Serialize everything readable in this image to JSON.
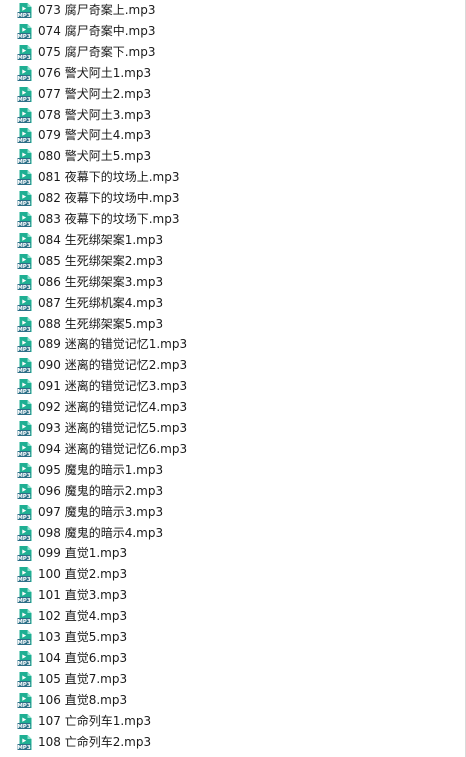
{
  "window": {
    "view": "file-list",
    "icon_name": "mp3-file-icon",
    "icon_label": "MP3",
    "colors": {
      "icon_teal": "#1faf93",
      "icon_fold": "#8fe3cf",
      "icon_badge": "#2d6f87",
      "text": "#1a1a1a",
      "background": "#ffffff"
    }
  },
  "files": [
    {
      "name": "073 腐尸奇案上.mp3"
    },
    {
      "name": "074 腐尸奇案中.mp3"
    },
    {
      "name": "075 腐尸奇案下.mp3"
    },
    {
      "name": "076 警犬阿土1.mp3"
    },
    {
      "name": "077 警犬阿土2.mp3"
    },
    {
      "name": "078 警犬阿土3.mp3"
    },
    {
      "name": "079 警犬阿土4.mp3"
    },
    {
      "name": "080 警犬阿土5.mp3"
    },
    {
      "name": "081 夜幕下的坟场上.mp3"
    },
    {
      "name": "082 夜幕下的坟场中.mp3"
    },
    {
      "name": "083 夜幕下的坟场下.mp3"
    },
    {
      "name": "084 生死绑架案1.mp3"
    },
    {
      "name": "085 生死绑架案2.mp3"
    },
    {
      "name": "086 生死绑架案3.mp3"
    },
    {
      "name": "087 生死绑机案4.mp3"
    },
    {
      "name": "088 生死绑架案5.mp3"
    },
    {
      "name": "089 迷离的错觉记忆1.mp3"
    },
    {
      "name": "090 迷离的错觉记忆2.mp3"
    },
    {
      "name": "091 迷离的错觉记忆3.mp3"
    },
    {
      "name": "092 迷离的错觉记忆4.mp3"
    },
    {
      "name": "093 迷离的错觉记忆5.mp3"
    },
    {
      "name": "094 迷离的错觉记忆6.mp3"
    },
    {
      "name": "095 魔鬼的暗示1.mp3"
    },
    {
      "name": "096 魔鬼的暗示2.mp3"
    },
    {
      "name": "097 魔鬼的暗示3.mp3"
    },
    {
      "name": "098 魔鬼的暗示4.mp3"
    },
    {
      "name": "099 直觉1.mp3"
    },
    {
      "name": "100 直觉2.mp3"
    },
    {
      "name": "101 直觉3.mp3"
    },
    {
      "name": "102 直觉4.mp3"
    },
    {
      "name": "103 直觉5.mp3"
    },
    {
      "name": "104 直觉6.mp3"
    },
    {
      "name": "105 直觉7.mp3"
    },
    {
      "name": "106 直觉8.mp3"
    },
    {
      "name": "107 亡命列车1.mp3"
    },
    {
      "name": "108 亡命列车2.mp3"
    }
  ]
}
